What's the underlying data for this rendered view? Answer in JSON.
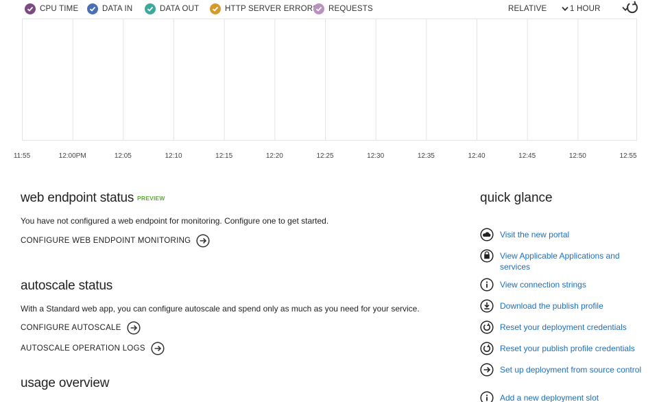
{
  "legend": {
    "items": [
      {
        "label": "CPU TIME",
        "color": "#7b4a82"
      },
      {
        "label": "DATA IN",
        "color": "#4a6fb5"
      },
      {
        "label": "DATA OUT",
        "color": "#3fa89c"
      },
      {
        "label": "HTTP SERVER ERRORS",
        "color": "#d69a2c"
      },
      {
        "label": "REQUESTS",
        "color": "#b993bd"
      }
    ],
    "mode_value": "RELATIVE",
    "range_value": "1 HOUR"
  },
  "chart_data": {
    "type": "line",
    "x_ticks": [
      "11:55",
      "12:00PM",
      "12:05",
      "12:10",
      "12:15",
      "12:20",
      "12:25",
      "12:30",
      "12:35",
      "12:40",
      "12:45",
      "12:50",
      "12:55"
    ],
    "series": [],
    "grid": true
  },
  "web_endpoint": {
    "title": "web endpoint status",
    "badge": "PREVIEW",
    "description": "You have not configured a web endpoint for monitoring. Configure one to get started.",
    "action": "CONFIGURE WEB ENDPOINT MONITORING"
  },
  "autoscale": {
    "title": "autoscale status",
    "description": "With a Standard web app, you can configure autoscale and spend only as much as you need for your service.",
    "action_configure": "CONFIGURE AUTOSCALE",
    "action_logs": "AUTOSCALE OPERATION LOGS"
  },
  "usage": {
    "title": "usage overview"
  },
  "quick_glance": {
    "title": "quick glance",
    "links": [
      {
        "label": "Visit the new portal",
        "icon": "cloud-icon"
      },
      {
        "label": "View Applicable Applications and services",
        "icon": "bag-icon"
      },
      {
        "label": "View connection strings",
        "icon": "info-icon"
      },
      {
        "label": "Download the publish profile",
        "icon": "download-icon"
      },
      {
        "label": "Reset your deployment credentials",
        "icon": "reset-icon"
      },
      {
        "label": "Reset your publish profile credentials",
        "icon": "reset-icon"
      },
      {
        "label": "Set up deployment from source control",
        "icon": "arrow-right-icon"
      },
      {
        "label": "Add a new deployment slot",
        "icon": "info-icon"
      }
    ]
  }
}
